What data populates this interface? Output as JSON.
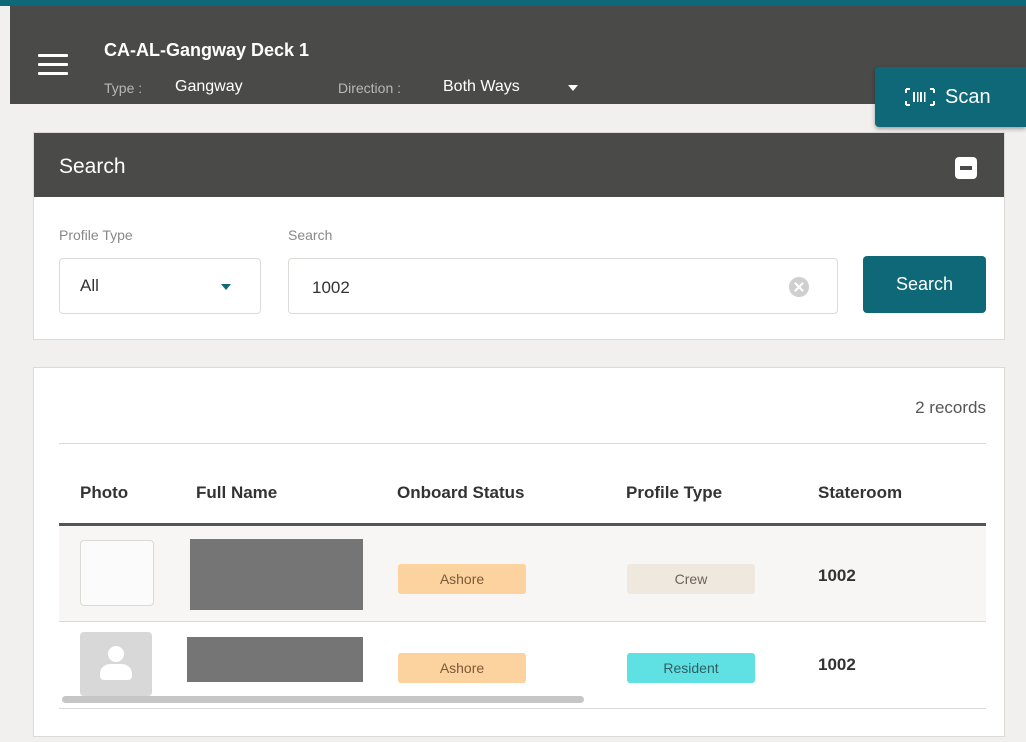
{
  "header": {
    "title": "CA-AL-Gangway Deck 1",
    "type_label": "Type :",
    "type_value": "Gangway",
    "direction_label": "Direction :",
    "direction_value": "Both Ways",
    "scan_label": "Scan",
    "icons": {
      "menu": "hamburger-menu-icon",
      "direction": "caret-down-icon",
      "scan": "barcode-scan-icon"
    }
  },
  "search_panel": {
    "title": "Search",
    "collapse_icon": "minus-square-icon",
    "profile_type_label": "Profile Type",
    "profile_type_value": "All",
    "search_label": "Search",
    "search_value": "1002",
    "search_button": "Search",
    "clear_icon": "clear-circle-icon"
  },
  "results": {
    "record_count": "2 records",
    "columns": [
      "Photo",
      "Full Name",
      "Onboard Status",
      "Profile Type",
      "Stateroom"
    ],
    "rows": [
      {
        "photo": "empty-photo",
        "full_name": "",
        "onboard_status": "Ashore",
        "profile_type": "Crew",
        "stateroom": "1002"
      },
      {
        "photo": "person-avatar-icon",
        "full_name": "",
        "onboard_status": "Ashore",
        "profile_type": "Resident",
        "stateroom": "1002"
      }
    ]
  },
  "colors": {
    "accent": "#0e6878",
    "header_bg": "#4a4a48",
    "ashore_badge": "#fcd29e",
    "crew_badge": "#efe8df",
    "resident_badge": "#5fe0e2",
    "redacted_name": "#757575"
  }
}
